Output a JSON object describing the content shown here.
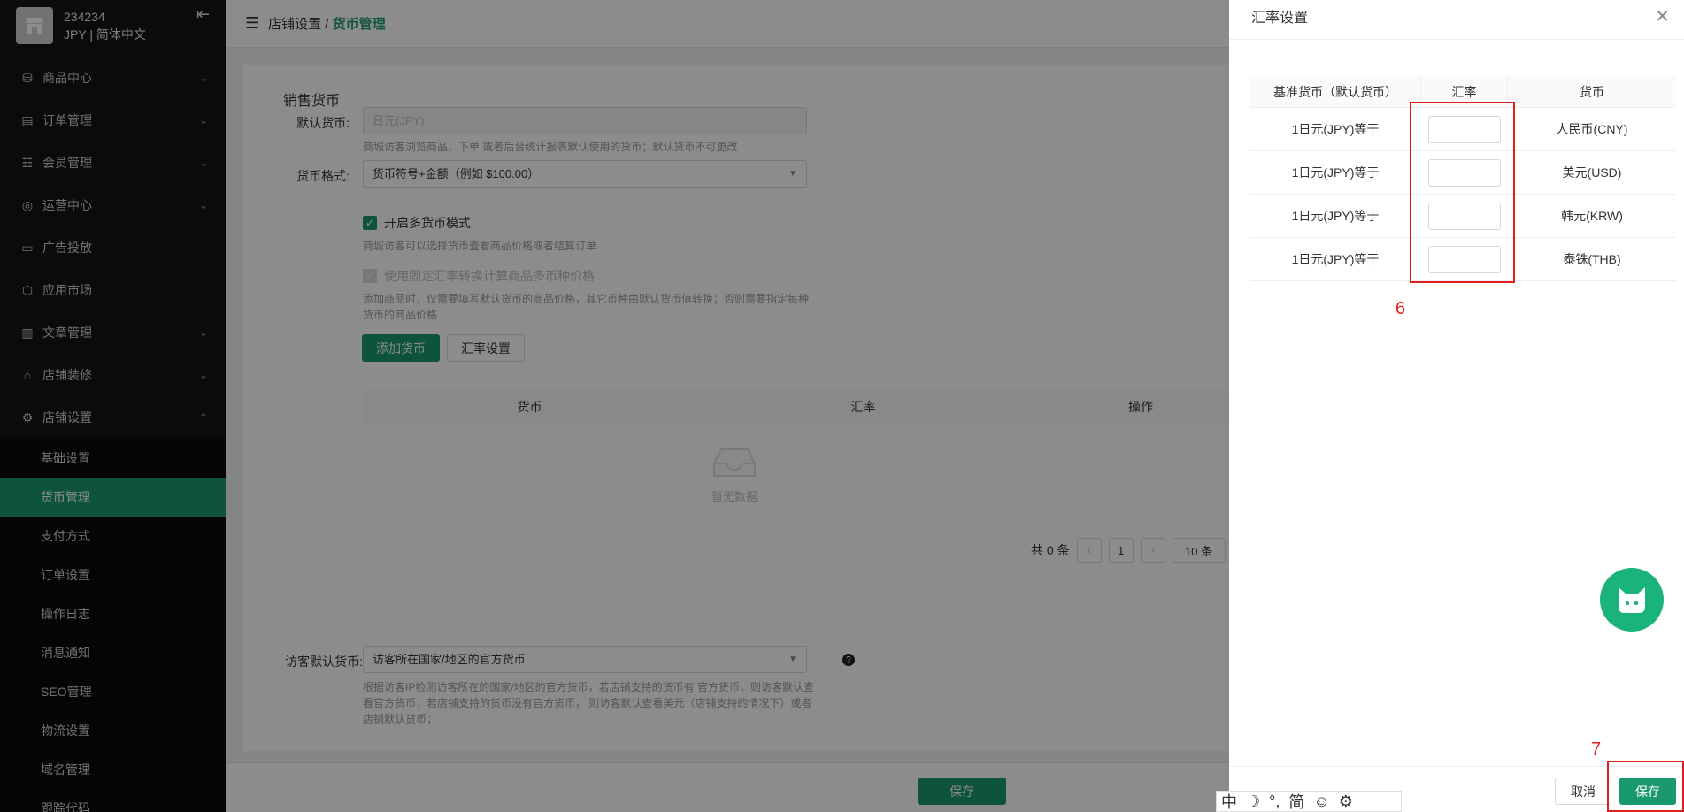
{
  "sidebar": {
    "store_name": "234234",
    "store_locale": "JPY | 简体中文",
    "menu": [
      {
        "label": "商品中心",
        "icon": "bag-icon",
        "chevron": "⌄"
      },
      {
        "label": "订单管理",
        "icon": "clipboard-icon",
        "chevron": "⌄"
      },
      {
        "label": "会员管理",
        "icon": "members-icon",
        "chevron": "⌄"
      },
      {
        "label": "运营中心",
        "icon": "rocket-icon",
        "chevron": "⌄"
      },
      {
        "label": "广告投放",
        "icon": "ad-icon",
        "chevron": ""
      },
      {
        "label": "应用市场",
        "icon": "cube-icon",
        "chevron": ""
      },
      {
        "label": "文章管理",
        "icon": "book-icon",
        "chevron": "⌄"
      },
      {
        "label": "店铺装修",
        "icon": "shop-icon",
        "chevron": "⌄"
      },
      {
        "label": "店铺设置",
        "icon": "gear-icon",
        "chevron": "⌃"
      }
    ],
    "submenu": [
      "基础设置",
      "货币管理",
      "支付方式",
      "订单设置",
      "操作日志",
      "消息通知",
      "SEO管理",
      "物流设置",
      "域名管理",
      "跟踪代码"
    ]
  },
  "topbar": {
    "crumb_parent": "店铺设置 / ",
    "crumb_current": "货币管理"
  },
  "form": {
    "section_title": "销售货币",
    "default_currency_label": "默认货币:",
    "default_currency_placeholder": "日元(JPY)",
    "default_currency_hint": "商城访客浏览商品、下单 或者后台统计报表默认使用的货币；默认货币不可更改",
    "format_label": "货币格式:",
    "format_value": "货币符号+金额（例如 $100.00）",
    "multi_currency_label": "开启多货币模式",
    "multi_currency_hint": "商城访客可以选择货币查看商品价格或者结算订单",
    "fixed_rate_label": "使用固定汇率转换计算商品多币种价格",
    "fixed_rate_hint": "添加商品时，仅需要填写默认货币的商品价格，其它币种由默认货币值转换；否则需要指定每种货币的商品价格",
    "add_currency_btn": "添加货币",
    "rate_setting_btn": "汇率设置",
    "table_headers": [
      "货币",
      "汇率",
      "操作"
    ],
    "empty_text": "暂无数据",
    "pager_total": "共 0 条",
    "pager_page": "1",
    "pager_size": "10 条",
    "visitor_label": "访客默认货币:",
    "visitor_value": "访客所在国家/地区的官方货币",
    "visitor_hint": "根据访客IP检测访客所在的国家/地区的官方货币，若店铺支持的货币有 官方货币，则访客默认查看官方货币；若店铺支持的货币没有官方货币， 则访客默认查看美元（店铺支持的情况下）或者店铺默认货币；",
    "save_btn": "保存"
  },
  "drawer": {
    "title": "汇率设置",
    "headers": [
      "基准货币（默认货币）",
      "汇率",
      "货币"
    ],
    "rows": [
      {
        "base": "1日元(JPY)等于",
        "rate": "",
        "currency": "人民币(CNY)"
      },
      {
        "base": "1日元(JPY)等于",
        "rate": "",
        "currency": "美元(USD)"
      },
      {
        "base": "1日元(JPY)等于",
        "rate": "",
        "currency": "韩元(KRW)"
      },
      {
        "base": "1日元(JPY)等于",
        "rate": "",
        "currency": "泰铢(THB)"
      }
    ],
    "annotation_6": "6",
    "annotation_7": "7",
    "cancel_btn": "取消",
    "save_btn": "保存"
  },
  "ime": {
    "items": [
      "中",
      "☽",
      "°,",
      "简",
      "☺",
      "⚙"
    ]
  },
  "colors": {
    "accent": "#1a9a6c",
    "annotation": "#e02020",
    "sidebar_bg": "#141414"
  }
}
